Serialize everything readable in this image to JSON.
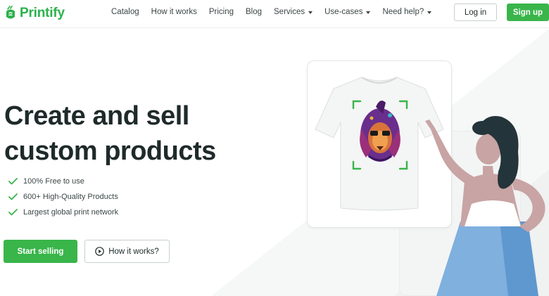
{
  "brand": {
    "name": "Printify",
    "color": "#2bb24c"
  },
  "nav": {
    "links": [
      {
        "label": "Catalog",
        "dropdown": false
      },
      {
        "label": "How it works",
        "dropdown": false
      },
      {
        "label": "Pricing",
        "dropdown": false
      },
      {
        "label": "Blog",
        "dropdown": false
      },
      {
        "label": "Services",
        "dropdown": true
      },
      {
        "label": "Use-cases",
        "dropdown": true
      },
      {
        "label": "Need help?",
        "dropdown": true
      }
    ],
    "login_label": "Log in",
    "signup_label": "Sign up"
  },
  "hero": {
    "headline_line1": "Create and sell",
    "headline_line2": "custom products",
    "features": [
      "100% Free to use",
      "600+ High-Quality Products",
      "Largest global print network"
    ],
    "start_label": "Start selling",
    "how_label": "How it works?"
  },
  "icons": {
    "logo": "printify-logo-icon",
    "check": "check-icon",
    "play": "play-circle-icon",
    "caret": "chevron-down-icon"
  },
  "colors": {
    "accent": "#39b54a",
    "text": "#1f2a2a",
    "border": "#c9cfcf"
  }
}
